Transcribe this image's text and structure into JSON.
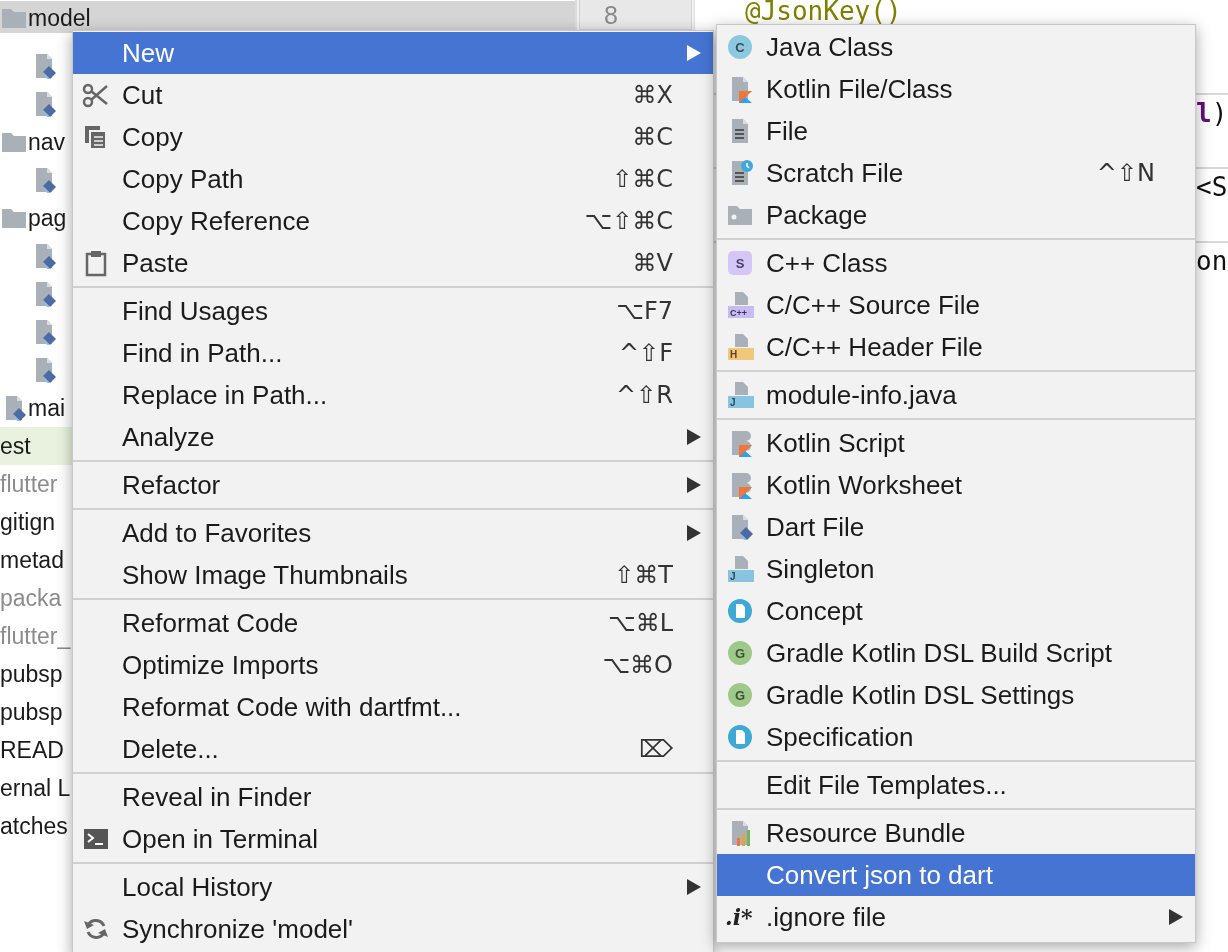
{
  "project_tree": {
    "items": [
      {
        "label": "model",
        "kind": "folder",
        "selected": true,
        "ignored": false,
        "children": [
          {
            "kind": "dart-file",
            "selected": false
          },
          {
            "kind": "dart-file",
            "selected": false
          }
        ]
      },
      {
        "label": "nav",
        "kind": "folder",
        "selected": false,
        "ignored": false,
        "children": [
          {
            "kind": "dart-file",
            "selected": false
          }
        ]
      },
      {
        "label": "pag",
        "kind": "folder",
        "selected": false,
        "ignored": false,
        "children": [
          {
            "kind": "dart-file",
            "selected": false
          },
          {
            "kind": "dart-file",
            "selected": false
          },
          {
            "kind": "dart-file",
            "selected": false
          },
          {
            "kind": "dart-file",
            "selected": false
          }
        ]
      },
      {
        "label": "mai",
        "kind": "dart-file",
        "selected": false,
        "ignored": false
      },
      {
        "label": "est",
        "kind": "test-root",
        "selected": false,
        "ignored": false
      },
      {
        "label": "flutter",
        "kind": "text",
        "selected": false,
        "ignored": true
      },
      {
        "label": "gitign",
        "kind": "text",
        "selected": false,
        "ignored": false
      },
      {
        "label": "metad",
        "kind": "text",
        "selected": false,
        "ignored": false
      },
      {
        "label": "packa",
        "kind": "text",
        "selected": false,
        "ignored": true
      },
      {
        "label": "flutter_",
        "kind": "text",
        "selected": false,
        "ignored": true
      },
      {
        "label": "pubsp",
        "kind": "text",
        "selected": false,
        "ignored": false
      },
      {
        "label": "pubsp",
        "kind": "text",
        "selected": false,
        "ignored": false
      },
      {
        "label": "READ",
        "kind": "text",
        "selected": false,
        "ignored": false
      },
      {
        "label": "ernal L",
        "kind": "text",
        "selected": false,
        "ignored": false
      },
      {
        "label": "atches",
        "kind": "text",
        "selected": false,
        "ignored": false
      }
    ]
  },
  "gutter": {
    "line_number": "8"
  },
  "editor": {
    "lines": [
      {
        "segments": [
          {
            "text": "@JsonKey()",
            "kind": "annotation"
          }
        ]
      },
      {
        "segments": [
          {
            "text": "l",
            "kind": "field"
          },
          {
            "text": ")",
            "kind": "plain"
          }
        ]
      },
      {
        "segments": [
          {
            "text": "<S",
            "kind": "plain"
          }
        ]
      },
      {
        "segments": [
          {
            "text": "on",
            "kind": "plain"
          }
        ]
      }
    ]
  },
  "context_menu": {
    "items": [
      {
        "kind": "item",
        "label": "New",
        "has_submenu": true,
        "selected": true
      },
      {
        "kind": "item",
        "label": "Cut",
        "shortcut": "⌘X",
        "has_submenu": false,
        "selected": false
      },
      {
        "kind": "item",
        "label": "Copy",
        "shortcut": "⌘C",
        "has_submenu": false,
        "selected": false
      },
      {
        "kind": "item",
        "label": "Copy Path",
        "shortcut": "⇧⌘C",
        "has_submenu": false,
        "selected": false
      },
      {
        "kind": "item",
        "label": "Copy Reference",
        "shortcut": "⌥⇧⌘C",
        "has_submenu": false,
        "selected": false
      },
      {
        "kind": "item",
        "label": "Paste",
        "shortcut": "⌘V",
        "has_submenu": false,
        "selected": false
      },
      {
        "kind": "separator"
      },
      {
        "kind": "item",
        "label": "Find Usages",
        "shortcut": "⌥F7",
        "has_submenu": false,
        "selected": false
      },
      {
        "kind": "item",
        "label": "Find in Path...",
        "shortcut": "^⇧F",
        "has_submenu": false,
        "selected": false
      },
      {
        "kind": "item",
        "label": "Replace in Path...",
        "shortcut": "^⇧R",
        "has_submenu": false,
        "selected": false
      },
      {
        "kind": "item",
        "label": "Analyze",
        "has_submenu": true,
        "selected": false
      },
      {
        "kind": "separator"
      },
      {
        "kind": "item",
        "label": "Refactor",
        "has_submenu": true,
        "selected": false
      },
      {
        "kind": "separator"
      },
      {
        "kind": "item",
        "label": "Add to Favorites",
        "has_submenu": true,
        "selected": false
      },
      {
        "kind": "item",
        "label": "Show Image Thumbnails",
        "shortcut": "⇧⌘T",
        "has_submenu": false,
        "selected": false
      },
      {
        "kind": "separator"
      },
      {
        "kind": "item",
        "label": "Reformat Code",
        "shortcut": "⌥⌘L",
        "has_submenu": false,
        "selected": false
      },
      {
        "kind": "item",
        "label": "Optimize Imports",
        "shortcut": "⌥⌘O",
        "has_submenu": false,
        "selected": false
      },
      {
        "kind": "item",
        "label": "Reformat Code with dartfmt...",
        "has_submenu": false,
        "selected": false
      },
      {
        "kind": "item",
        "label": "Delete...",
        "shortcut": "⌦",
        "has_submenu": false,
        "selected": false
      },
      {
        "kind": "separator"
      },
      {
        "kind": "item",
        "label": "Reveal in Finder",
        "has_submenu": false,
        "selected": false
      },
      {
        "kind": "item",
        "label": "Open in Terminal",
        "has_submenu": false,
        "selected": false
      },
      {
        "kind": "separator"
      },
      {
        "kind": "item",
        "label": "Local History",
        "has_submenu": true,
        "selected": false
      },
      {
        "kind": "item",
        "label": "Synchronize 'model'",
        "has_submenu": false,
        "selected": false
      }
    ]
  },
  "new_submenu": {
    "items": [
      {
        "kind": "item",
        "label": "Java Class",
        "icon_text": "C",
        "has_submenu": false,
        "selected": false
      },
      {
        "kind": "item",
        "label": "Kotlin File/Class",
        "has_submenu": false,
        "selected": false
      },
      {
        "kind": "item",
        "label": "File",
        "has_submenu": false,
        "selected": false
      },
      {
        "kind": "item",
        "label": "Scratch File",
        "shortcut": "^⇧N",
        "has_submenu": false,
        "selected": false
      },
      {
        "kind": "item",
        "label": "Package",
        "has_submenu": false,
        "selected": false
      },
      {
        "kind": "separator"
      },
      {
        "kind": "item",
        "label": "C++ Class",
        "icon_text": "S",
        "has_submenu": false,
        "selected": false
      },
      {
        "kind": "item",
        "label": "C/C++ Source File",
        "icon_text": "C++",
        "has_submenu": false,
        "selected": false
      },
      {
        "kind": "item",
        "label": "C/C++ Header File",
        "icon_text": "H",
        "has_submenu": false,
        "selected": false
      },
      {
        "kind": "separator"
      },
      {
        "kind": "item",
        "label": "module-info.java",
        "icon_text": "J",
        "has_submenu": false,
        "selected": false
      },
      {
        "kind": "separator"
      },
      {
        "kind": "item",
        "label": "Kotlin Script",
        "has_submenu": false,
        "selected": false
      },
      {
        "kind": "item",
        "label": "Kotlin Worksheet",
        "has_submenu": false,
        "selected": false
      },
      {
        "kind": "item",
        "label": "Dart File",
        "has_submenu": false,
        "selected": false
      },
      {
        "kind": "item",
        "label": "Singleton",
        "icon_text": "J",
        "has_submenu": false,
        "selected": false
      },
      {
        "kind": "item",
        "label": "Concept",
        "has_submenu": false,
        "selected": false
      },
      {
        "kind": "item",
        "label": "Gradle Kotlin DSL Build Script",
        "icon_text": "G",
        "has_submenu": false,
        "selected": false
      },
      {
        "kind": "item",
        "label": "Gradle Kotlin DSL Settings",
        "icon_text": "G",
        "has_submenu": false,
        "selected": false
      },
      {
        "kind": "item",
        "label": "Specification",
        "has_submenu": false,
        "selected": false
      },
      {
        "kind": "separator"
      },
      {
        "kind": "item",
        "label": "Edit File Templates...",
        "has_submenu": false,
        "selected": false
      },
      {
        "kind": "separator"
      },
      {
        "kind": "item",
        "label": "Resource Bundle",
        "has_submenu": false,
        "selected": false
      },
      {
        "kind": "item",
        "label": "Convert json to dart",
        "has_submenu": false,
        "selected": true
      },
      {
        "kind": "item",
        "label": ".ignore file",
        "icon_text": ".i*",
        "has_submenu": true,
        "selected": false
      }
    ]
  }
}
